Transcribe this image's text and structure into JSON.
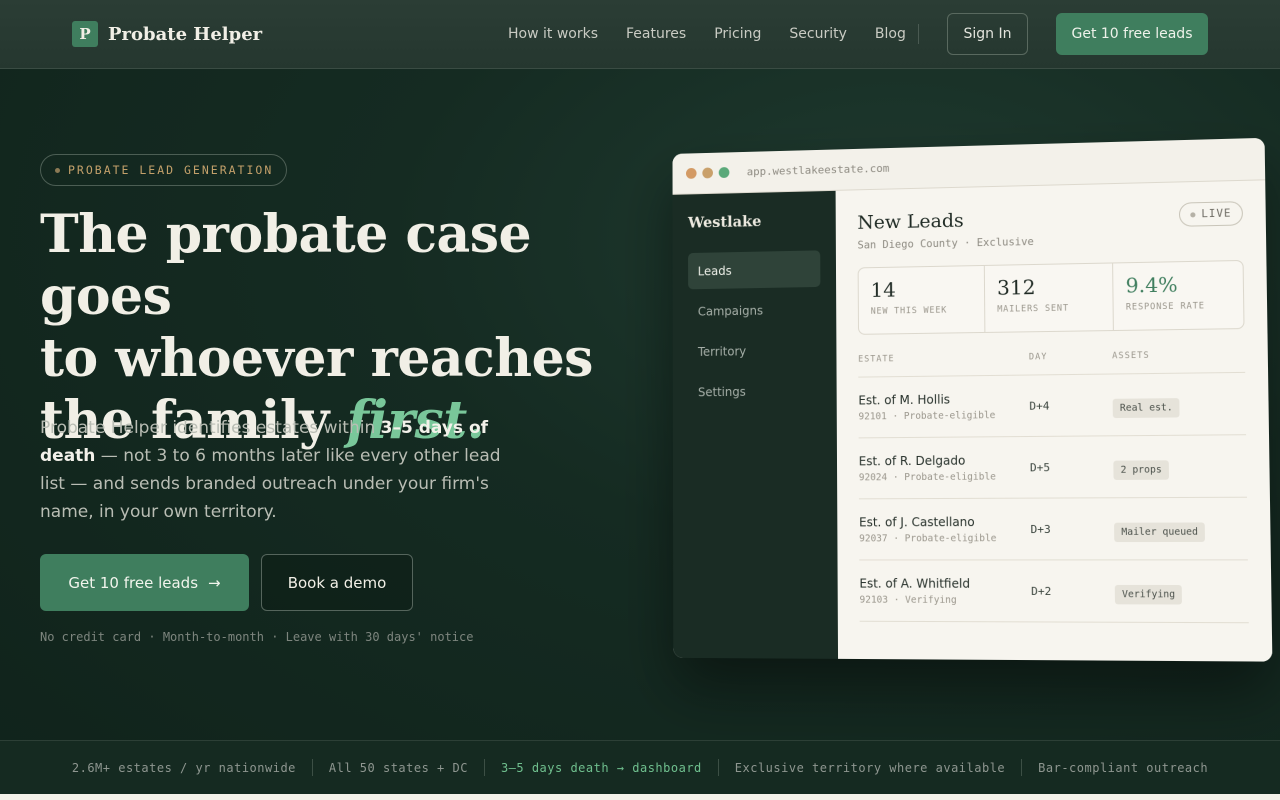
{
  "nav": {
    "logo_letter": "P",
    "brand": "Probate Helper",
    "links": [
      "How it works",
      "Features",
      "Pricing",
      "Security",
      "Blog"
    ],
    "sign_in": "Sign In",
    "cta": "Get 10 free leads"
  },
  "hero": {
    "badge": "PROBATE LEAD GENERATION",
    "headline_line1": "The probate case goes",
    "headline_line2": "to whoever reaches",
    "headline_line3": "the family",
    "headline_accent": "first.",
    "sub_part1": "Probate Helper identifies estates within ",
    "sub_strong": "3–5 days of death",
    "sub_part2": " — not 3 to 6 months later like every other lead list — and sends branded outreach under your firm's name, in your own territory.",
    "primary_button": "Get 10 free leads",
    "primary_arrow": "→",
    "secondary_button": "Book a demo",
    "fineprint": "No credit card · Month-to-month · Leave with 30 days' notice"
  },
  "mockup": {
    "url": "app.westlakeestate.com",
    "brand": "Westlake",
    "sidebar": [
      "Leads",
      "Campaigns",
      "Territory",
      "Settings"
    ],
    "title": "New Leads",
    "subtitle": "San Diego County · Exclusive",
    "live": "LIVE",
    "stats": [
      {
        "value": "14",
        "label": "NEW THIS WEEK"
      },
      {
        "value": "312",
        "label": "MAILERS SENT"
      },
      {
        "value": "9.4%",
        "label": "RESPONSE RATE"
      }
    ],
    "columns": [
      "ESTATE",
      "DAY",
      "ASSETS"
    ],
    "rows": [
      {
        "name": "Est. of M. Hollis",
        "meta": "92101 · Probate-eligible",
        "day": "D+4",
        "asset": "Real est."
      },
      {
        "name": "Est. of R. Delgado",
        "meta": "92024 · Probate-eligible",
        "day": "D+5",
        "asset": "2 props"
      },
      {
        "name": "Est. of J. Castellano",
        "meta": "92037 · Probate-eligible",
        "day": "D+3",
        "asset": "Mailer queued"
      },
      {
        "name": "Est. of A. Whitfield",
        "meta": "92103 · Verifying",
        "day": "D+2",
        "asset": "Verifying"
      }
    ]
  },
  "strip": [
    "2.6M+ estates / yr nationwide",
    "All 50 states + DC",
    "3–5 days death → dashboard",
    "Exclusive territory where available",
    "Bar-compliant outreach"
  ],
  "colors": {
    "accent": "#3f7e5e",
    "accent_text": "#79c79a",
    "background": "#152b22"
  }
}
